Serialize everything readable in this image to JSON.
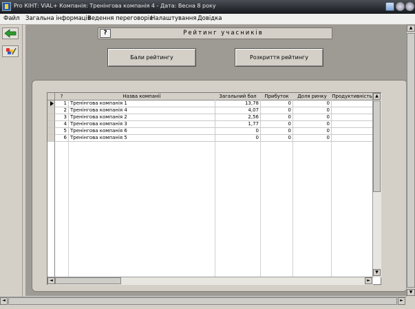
{
  "window": {
    "title": "Pro КІНТ: ViAL+   Компанія: Тренінгова компанія 4 - Дата: Весна 8 року"
  },
  "menu": [
    "Файл",
    "Загальна інформація",
    "Ведення переговорів",
    "Налаштування",
    "Довідка"
  ],
  "panel": {
    "help_label": "?",
    "title": "Рейтинг учасників",
    "button_scores": "Бали рейтингу",
    "button_disclosure": "Розкриття рейтингу"
  },
  "grid": {
    "columns": [
      "?",
      "Назва компанії",
      "Загальний бал",
      "Прибуток",
      "Доля ринку",
      "Продуктивність"
    ],
    "rows": [
      {
        "rank": "1",
        "name": "Тренінгова компанія 1",
        "total": "13,78",
        "profit": "0",
        "share": "0",
        "productivity": ""
      },
      {
        "rank": "2",
        "name": "Тренінгова компанія 4",
        "total": "4,07",
        "profit": "0",
        "share": "0",
        "productivity": ""
      },
      {
        "rank": "3",
        "name": "Тренінгова компанія 2",
        "total": "2,56",
        "profit": "0",
        "share": "0",
        "productivity": ""
      },
      {
        "rank": "4",
        "name": "Тренінгова компанія 3",
        "total": "1,77",
        "profit": "0",
        "share": "0",
        "productivity": ""
      },
      {
        "rank": "5",
        "name": "Тренінгова компанія 6",
        "total": "0",
        "profit": "0",
        "share": "0",
        "productivity": ""
      },
      {
        "rank": "6",
        "name": "Тренінгова компанія 5",
        "total": "0",
        "profit": "0",
        "share": "0",
        "productivity": ""
      }
    ],
    "current_row_index": 0
  },
  "icons": {
    "app": "app-icon",
    "back": "arrow-left-icon",
    "tools": "paint-tools-icon",
    "doc": "document-icon",
    "minimize": "minimize-icon",
    "close": "close-icon"
  },
  "colors": {
    "titlebar": "#16191d",
    "panel_bg": "#9e9b95",
    "face": "#d4d0c8",
    "green_arrow": "#2e9a2e"
  }
}
